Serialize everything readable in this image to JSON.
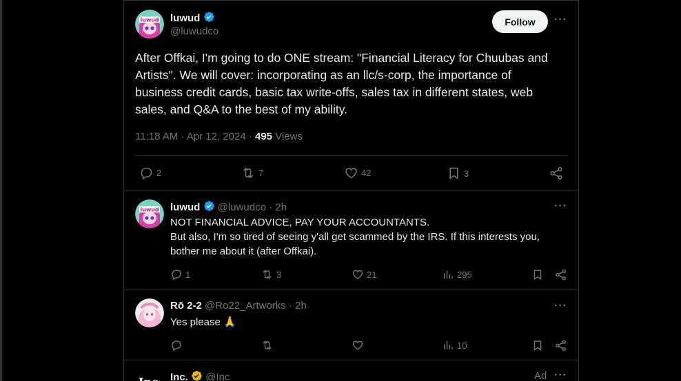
{
  "colors": {
    "accent": "#1d9bf0",
    "background": "#000000",
    "text": "#e7e9ea",
    "muted": "#71767b",
    "border": "#2f3336",
    "gold": "#e2b719"
  },
  "main_tweet": {
    "author_name": "luwud",
    "author_handle": "@luwudco",
    "follow_label": "Follow",
    "more_label": "···",
    "text_lines": [
      "After Offkai, I'm going to do ONE stream: \"Financial Literacy for Chuubas and",
      "Artists\". We will cover: incorporating as an llc/s-corp, the importance of",
      "business credit cards, basic tax write-offs, sales tax in different states, web",
      "sales, and Q&A to the best of my ability."
    ],
    "timestamp": "11:18 AM · Apr 12, 2024 · ",
    "views_count": "495",
    "views_label": "Views",
    "replies": "2",
    "reposts": "7",
    "likes": "42",
    "bookmarks": "3"
  },
  "replies": [
    {
      "author_name": "luwud",
      "author_handle": "@luwudco",
      "time": "· 2h",
      "lines": [
        "NOT FINANCIAL ADVICE, PAY YOUR ACCOUNTANTS.",
        "But also, I'm so tired of seeing y'all get scammed by the IRS. If this interests you,",
        "bother me about it (after Offkai)."
      ],
      "replies": "1",
      "reposts": "3",
      "likes": "21",
      "views": "295",
      "more_label": "···"
    },
    {
      "author_name": "Rō 2-2",
      "author_handle": "@Ro22_Artworks",
      "time": "· 2h",
      "lines": [
        "Yes please 🙏"
      ],
      "views": "10",
      "more_label": "···"
    }
  ],
  "ad_tweet": {
    "author_name": "Inc.",
    "author_handle": "@Inc",
    "ad_label": "Ad",
    "more_label": "···",
    "avatar_text": "Inc."
  },
  "icons": [
    "avatar",
    "verified-icon",
    "reply-icon",
    "repost-icon",
    "like-icon",
    "bookmark-icon",
    "share-icon",
    "views-icon",
    "more-icon"
  ]
}
